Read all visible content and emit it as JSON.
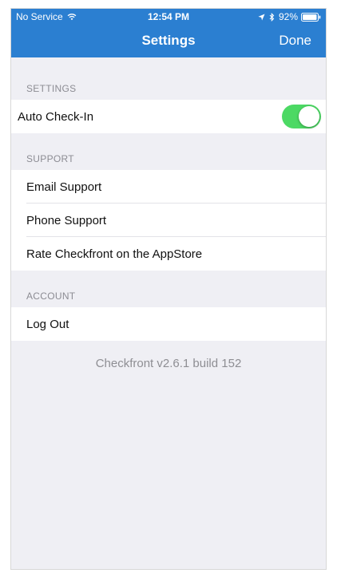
{
  "status_bar": {
    "carrier": "No Service",
    "time": "12:54 PM",
    "battery": "92%"
  },
  "nav": {
    "title": "Settings",
    "done_label": "Done"
  },
  "sections": {
    "settings": {
      "header": "SETTINGS",
      "auto_checkin_label": "Auto Check-In",
      "auto_checkin_on": true
    },
    "support": {
      "header": "SUPPORT",
      "items": [
        "Email Support",
        "Phone Support",
        "Rate Checkfront on the AppStore"
      ]
    },
    "account": {
      "header": "ACCOUNT",
      "logout_label": "Log Out"
    }
  },
  "version_text": "Checkfront v2.6.1 build 152",
  "colors": {
    "nav_bar": "#2b7fd1",
    "toggle_on": "#4cd964",
    "background": "#efeff4"
  },
  "icons": [
    "wifi-icon",
    "location-arrow-icon",
    "bluetooth-icon",
    "battery-icon"
  ]
}
